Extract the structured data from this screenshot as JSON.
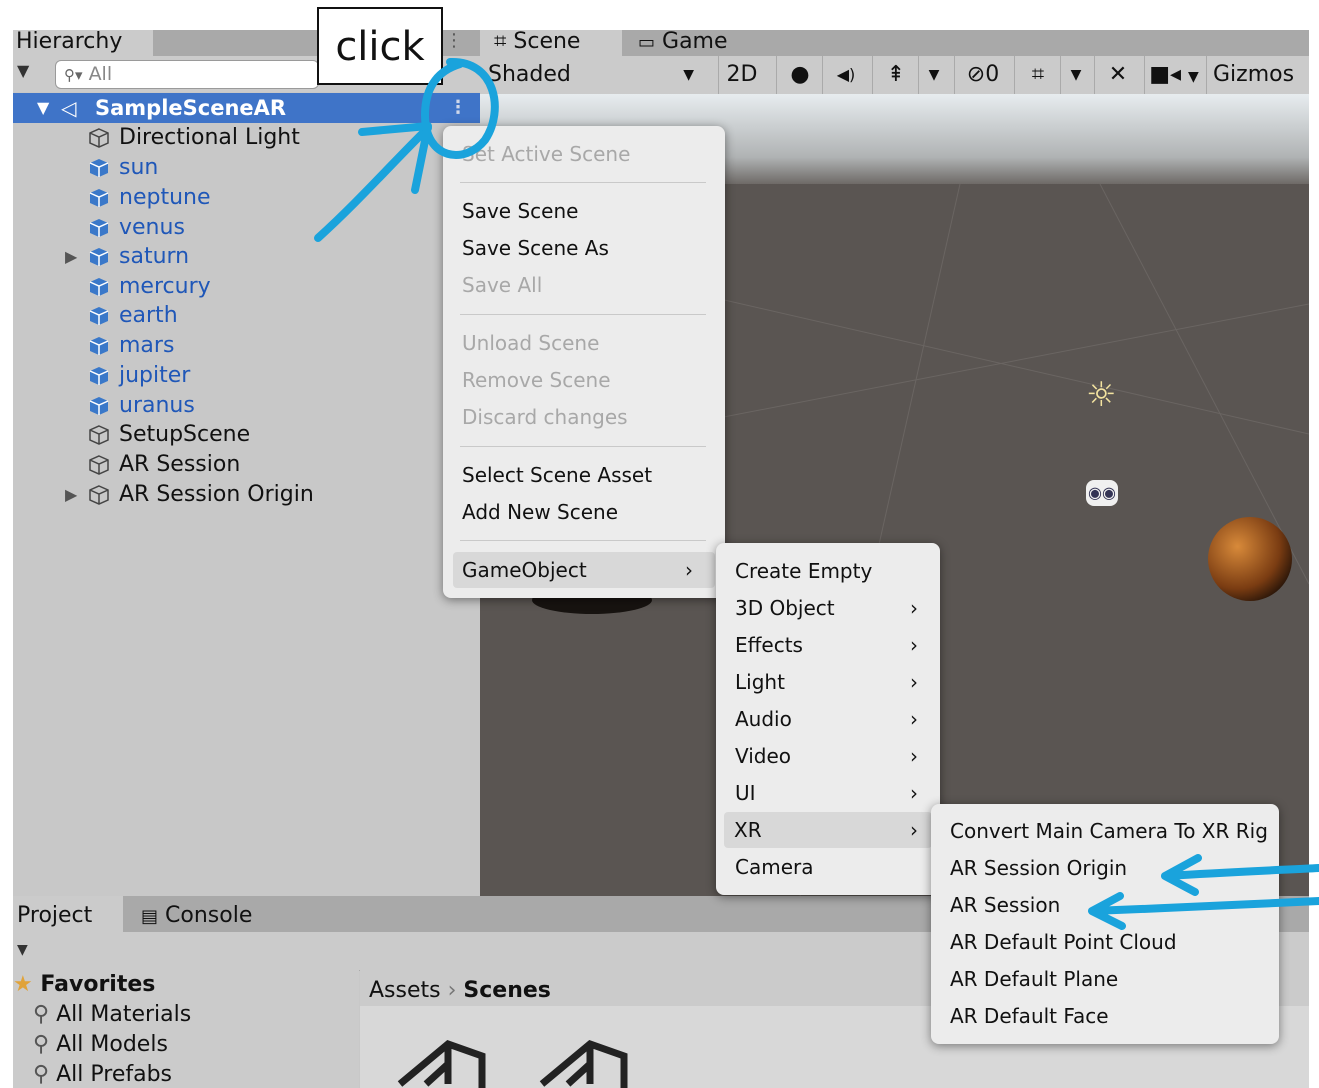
{
  "annotation": {
    "click_label": "click"
  },
  "hierarchy": {
    "tab_label": "Hierarchy",
    "search_placeholder": "All",
    "scene_name": "SampleSceneAR",
    "items": [
      {
        "label": "Directional Light"
      },
      {
        "label": "sun"
      },
      {
        "label": "neptune"
      },
      {
        "label": "venus"
      },
      {
        "label": "saturn"
      },
      {
        "label": "mercury"
      },
      {
        "label": "earth"
      },
      {
        "label": "mars"
      },
      {
        "label": "jupiter"
      },
      {
        "label": "uranus"
      },
      {
        "label": "SetupScene"
      },
      {
        "label": "AR Session"
      },
      {
        "label": "AR Session Origin"
      }
    ]
  },
  "scene_view": {
    "tab_scene": "Scene",
    "tab_game": "Game",
    "shading_mode": "Shaded",
    "toggle_2d": "2D",
    "hidden_count": "0",
    "gizmos_label": "Gizmos"
  },
  "context_menu": {
    "items": [
      {
        "label": "Set Active Scene"
      },
      {
        "label": "Save Scene"
      },
      {
        "label": "Save Scene As"
      },
      {
        "label": "Save All"
      },
      {
        "label": "Unload Scene"
      },
      {
        "label": "Remove Scene"
      },
      {
        "label": "Discard changes"
      },
      {
        "label": "Select Scene Asset"
      },
      {
        "label": "Add New Scene"
      },
      {
        "label": "GameObject"
      }
    ]
  },
  "gameobject_menu": {
    "items": [
      {
        "label": "Create Empty"
      },
      {
        "label": "3D Object"
      },
      {
        "label": "Effects"
      },
      {
        "label": "Light"
      },
      {
        "label": "Audio"
      },
      {
        "label": "Video"
      },
      {
        "label": "UI"
      },
      {
        "label": "XR"
      },
      {
        "label": "Camera"
      }
    ]
  },
  "xr_menu": {
    "items": [
      {
        "label": "Convert Main Camera To XR Rig"
      },
      {
        "label": "AR Session Origin"
      },
      {
        "label": "AR Session"
      },
      {
        "label": "AR Default Point Cloud"
      },
      {
        "label": "AR Default Plane"
      },
      {
        "label": "AR Default Face"
      }
    ]
  },
  "bottom": {
    "tab_project": "Project",
    "tab_console": "Console",
    "favorites_label": "Favorites",
    "favorites": [
      {
        "label": "All Materials"
      },
      {
        "label": "All Models"
      },
      {
        "label": "All Prefabs"
      }
    ],
    "breadcrumb_root": "Assets",
    "breadcrumb_current": "Scenes"
  },
  "colors": {
    "selection": "#3f74c8",
    "annotation_blue": "#1aa3dc"
  }
}
